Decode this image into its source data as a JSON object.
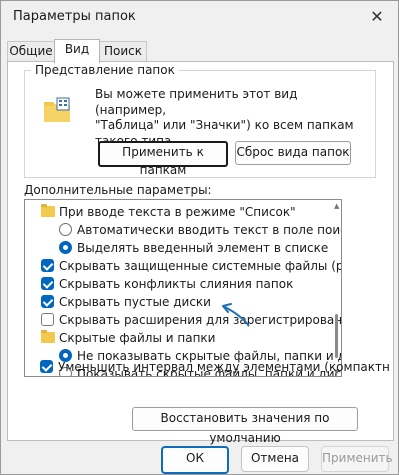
{
  "window": {
    "title": "Параметры папок"
  },
  "tabs": [
    {
      "label": "Общие"
    },
    {
      "label": "Вид"
    },
    {
      "label": "Поиск"
    }
  ],
  "folder_view": {
    "legend": "Представление папок",
    "line1": "Вы можете применить этот вид (например,",
    "line2": "\"Таблица\" или \"Значки\") ко всем папкам",
    "line3": "такого типа.",
    "apply_button": "Применить к папкам",
    "reset_button": "Сброс вида папок"
  },
  "advanced": {
    "label": "Дополнительные параметры:",
    "items": [
      {
        "type": "folder",
        "text": "При вводе текста в режиме \"Список\""
      },
      {
        "type": "radio",
        "checked": false,
        "text": "Автоматически вводить текст в поле поиска"
      },
      {
        "type": "radio",
        "checked": true,
        "text": "Выделять введенный элемент в списке"
      },
      {
        "type": "checkbox",
        "checked": true,
        "text": "Скрывать защищенные системные файлы (рекомен,"
      },
      {
        "type": "checkbox",
        "checked": true,
        "text": "Скрывать конфликты слияния папок"
      },
      {
        "type": "checkbox",
        "checked": true,
        "text": "Скрывать пустые диски"
      },
      {
        "type": "checkbox",
        "checked": false,
        "text": "Скрывать расширения для зарегистрированных типо"
      },
      {
        "type": "folder",
        "text": "Скрытые файлы и папки"
      },
      {
        "type": "radio",
        "checked": true,
        "text": "Не показывать скрытые файлы, папки и диски"
      },
      {
        "type": "radio",
        "checked": false,
        "text": "Показывать скрытые файлы, папки и диски"
      },
      {
        "type": "checkbox",
        "checked": true,
        "text": "Уменьшить интервал между элементами (компактн"
      }
    ],
    "restore_button": "Восстановить значения по умолчанию"
  },
  "footer": {
    "ok": "ОК",
    "cancel": "Отмена",
    "apply": "Применить"
  },
  "colors": {
    "accent": "#0067c0",
    "folder": "#f2c94c",
    "annotation_arrow": "#1f6fb7"
  }
}
